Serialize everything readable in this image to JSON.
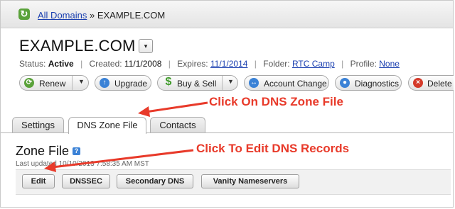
{
  "breadcrumb": {
    "all_domains": "All Domains",
    "separator": "»",
    "current": "EXAMPLE.COM"
  },
  "domain": {
    "name": "EXAMPLE.COM",
    "dropdown_glyph": "▾"
  },
  "status": {
    "status_label": "Status:",
    "status_value": "Active",
    "created_label": "Created:",
    "created_value": "11/1/2008",
    "expires_label": "Expires:",
    "expires_value": "11/1/2014",
    "folder_label": "Folder:",
    "folder_value": "RTC Camp",
    "profile_label": "Profile:",
    "profile_value": "None"
  },
  "toolbar": {
    "renew": "Renew",
    "upgrade": "Upgrade",
    "buy_sell": "Buy & Sell",
    "account_change": "Account Change",
    "diagnostics": "Diagnostics",
    "delete": "Delete"
  },
  "tabs": {
    "settings": "Settings",
    "dns_zone_file": "DNS Zone File",
    "contacts": "Contacts"
  },
  "zone": {
    "title": "Zone File",
    "last_updated": "Last updated 10/10/2013 7:58:35 AM MST"
  },
  "actions": {
    "edit": "Edit",
    "dnssec": "DNSSEC",
    "secondary_dns": "Secondary DNS",
    "vanity_nameservers": "Vanity Nameservers"
  },
  "annotations": {
    "callout_tab": "Click On DNS Zone File",
    "callout_edit": "Click To Edit DNS Records"
  },
  "colors": {
    "link": "#1a3fb0",
    "callout": "#e83a2a",
    "renew_icon": "#5aa23a",
    "upgrade_icon": "#3b82d6",
    "buysell_icon": "#3f9a2a",
    "delete_icon": "#d43a2a"
  }
}
